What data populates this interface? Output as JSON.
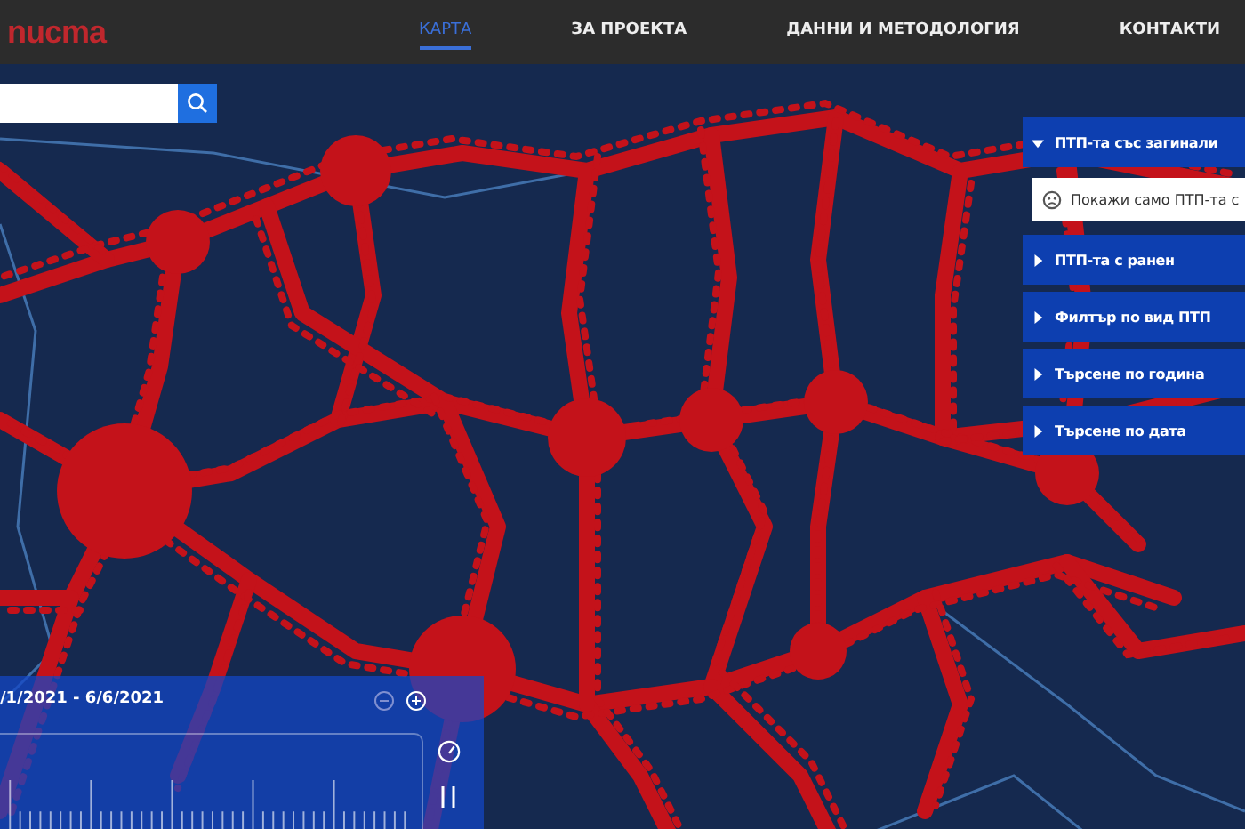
{
  "header": {
    "logo": "nucma",
    "nav": [
      {
        "label": "КАРТА",
        "selected": true
      },
      {
        "label": "ЗА ПРОЕКТА",
        "selected": false
      },
      {
        "label": "ДАННИ И МЕТОДОЛОГИЯ",
        "selected": false
      },
      {
        "label": "КОНТАКТИ",
        "selected": false
      }
    ]
  },
  "filters": [
    {
      "kind": "section",
      "label": "ПТП-та със загинали",
      "expanded": true
    },
    {
      "kind": "option",
      "label": "Покажи само ПТП-та с",
      "checked": false
    },
    {
      "kind": "section",
      "label": "ПТП-та с ранен",
      "expanded": false
    },
    {
      "kind": "section",
      "label": "Филтър по вид ПТП",
      "expanded": false
    },
    {
      "kind": "section",
      "label": "Търсене по година",
      "expanded": false
    },
    {
      "kind": "section",
      "label": "Търсене по дата",
      "expanded": false
    }
  ],
  "timeline": {
    "date_range": "/1/2021 - 6/6/2021",
    "zoom_out_disabled": true,
    "zoom_in_disabled": false,
    "playing": true
  }
}
